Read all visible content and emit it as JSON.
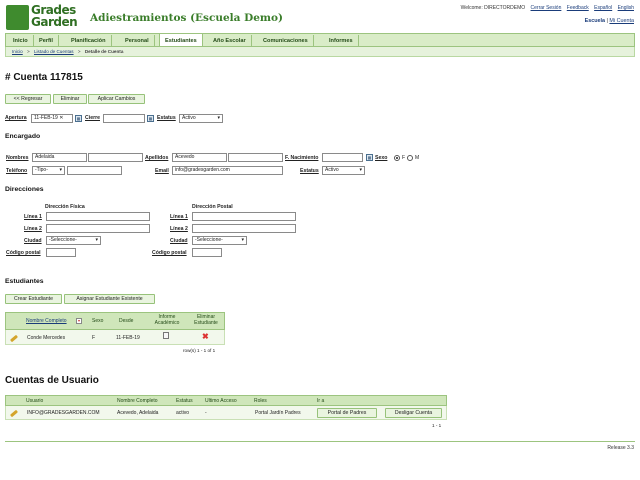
{
  "header": {
    "logo_line1": "Grades",
    "logo_line2": "Garden",
    "app_title": "Adiestramientos (Escuela Demo)",
    "welcome": "Welcome: DIRECTORDEMO",
    "links": [
      "Cerrar Sesión",
      "Feedback",
      "Español",
      "English"
    ],
    "school": "Escuela",
    "my_account": "Mi Cuenta"
  },
  "nav": {
    "items": [
      "Inicio",
      "Perfil",
      "Planificación",
      "Personal",
      "Estudiantes",
      "Año Escolar",
      "Comunicaciones",
      "Informes"
    ],
    "active": "Estudiantes"
  },
  "breadcrumb": [
    "Inicio",
    ">",
    "Listado de Cuentas",
    ">",
    "Detalle de Cuenta"
  ],
  "page": {
    "title": "# Cuenta 117815",
    "buttons": [
      "<< Regresar",
      "Eliminar",
      "Aplicar Cambios"
    ]
  },
  "account": {
    "apertura_label": "Apertura",
    "apertura_value": "11-FEB-19",
    "cierre_label": "Cierre",
    "cierre_value": "",
    "estatus_label": "Estatus",
    "estatus_value": "Activo"
  },
  "encargado": {
    "section": "Encargado",
    "nombres_label": "Nombres",
    "nombres_value": "Adelaida",
    "apellidos_label": "Apellidos",
    "apellidos_value": "Acevedo",
    "nacimiento_label": "F. Nacimiento",
    "sexo_label": "Sexo",
    "sexo_f": "F",
    "sexo_m": "M",
    "telefono_label": "Teléfono",
    "telefono_tipo": "-Tipo-",
    "email_label": "Email",
    "email_value": "info@gradesgarden.com",
    "estatus_label": "Estatus",
    "estatus_value": "Activo"
  },
  "direcciones": {
    "section": "Direcciones",
    "fisica_header": "Dirección Física",
    "postal_header": "Dirección Postal",
    "linea1": "Línea 1",
    "linea2": "Línea 2",
    "ciudad": "Ciudad",
    "ciudad_select": "-Seleccione-",
    "codigo": "Código postal"
  },
  "estudiantes": {
    "section": "Estudiantes",
    "buttons": [
      "Crear Estudiante",
      "Asignar Estudiante Existente"
    ],
    "columns": [
      "Nombre Completo",
      "Sexo",
      "Desde",
      "Informe Académico",
      "Eliminar Estudiante"
    ],
    "rows": [
      {
        "nombre": "Conde Mercedes",
        "sexo": "F",
        "desde": "11-FEB-19"
      }
    ],
    "pagination": "row(s) 1 - 1 of 1"
  },
  "cuentas": {
    "section": "Cuentas de Usuario",
    "columns": [
      "Usuario",
      "Nombre Completo",
      "Estatus",
      "Ultimo Acceso",
      "Roles",
      "Ir a"
    ],
    "rows": [
      {
        "usuario": "INFO@GRADESGARDEN.COM",
        "nombre": "Acevedo, Adelaida",
        "estatus": "activo",
        "ultimo": "-",
        "roles": "Portal Jardín Padres",
        "btn1": "Portal de Padres",
        "btn2": "Desligar Cuenta"
      }
    ],
    "pagination": "1 - 1"
  },
  "footer": {
    "release": "Release 3.3"
  },
  "colors": {
    "brand_green": "#3f8b2e",
    "nav_bg": "#d9ecc7",
    "delete_red": "#dd3333"
  }
}
